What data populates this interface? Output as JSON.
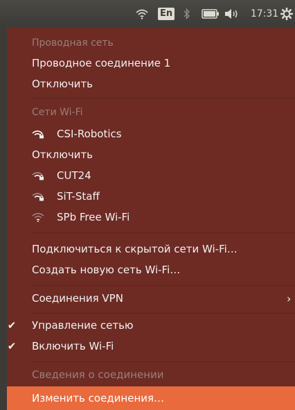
{
  "topbar": {
    "language": "En",
    "clock": "17:31",
    "icons": [
      "wifi-icon",
      "keyboard-layout-indicator",
      "bluetooth-icon",
      "battery-icon",
      "volume-icon",
      "gear-icon"
    ]
  },
  "menu": {
    "wired_header": "Проводная сеть",
    "wired_connection": "Проводное соединение 1",
    "wired_disconnect": "Отключить",
    "wifi_header": "Сети Wi-Fi",
    "networks": [
      {
        "name": "CSI-Robotics",
        "signal": "secured"
      },
      {
        "name": "CUT24",
        "signal": "secured"
      },
      {
        "name": "SiT-Staff",
        "signal": "secured"
      },
      {
        "name": "SPb Free Wi-Fi",
        "signal": "open"
      }
    ],
    "wifi_disconnect": "Отключить",
    "hidden_network": "Подключиться к скрытой сети Wi-Fi…",
    "create_network": "Создать новую сеть Wi-Fi…",
    "vpn": "Соединения VPN",
    "vpn_arrow": "›",
    "check_mark": "✔",
    "manage_network": "Управление сетью",
    "enable_wifi": "Включить Wi-Fi",
    "connection_info": "Сведения о соединении",
    "edit_connections": "Изменить соединения…"
  },
  "colors": {
    "menu_bg": "#6d2b24",
    "panel_bg": "#3c3b37",
    "highlight": "#e96a3d",
    "disabled_text": "#9a7f78"
  }
}
